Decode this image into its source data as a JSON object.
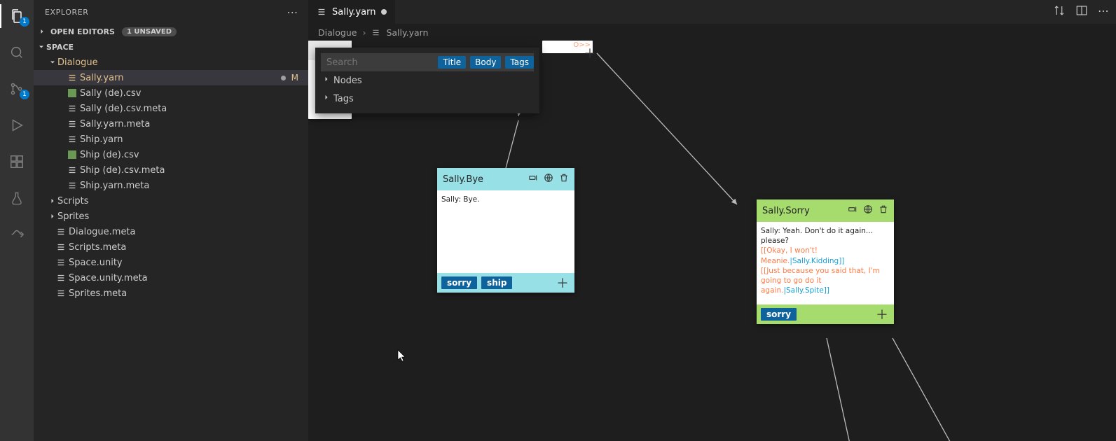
{
  "activity": {
    "badge_files": "1",
    "badge_scm": "1"
  },
  "explorer": {
    "title": "EXPLORER",
    "open_editors": "OPEN EDITORS",
    "unsaved_label": "1 UNSAVED",
    "workspace": "SPACE",
    "folders": {
      "dialogue": "Dialogue",
      "scripts": "Scripts",
      "sprites": "Sprites"
    },
    "files": {
      "sally_yarn": "Sally.yarn",
      "sally_de_csv": "Sally (de).csv",
      "sally_de_csv_meta": "Sally (de).csv.meta",
      "sally_yarn_meta": "Sally.yarn.meta",
      "ship_yarn": "Ship.yarn",
      "ship_de_csv": "Ship (de).csv",
      "ship_de_csv_meta": "Ship (de).csv.meta",
      "ship_yarn_meta": "Ship.yarn.meta",
      "dialogue_meta": "Dialogue.meta",
      "scripts_meta": "Scripts.meta",
      "space_unity": "Space.unity",
      "space_unity_meta": "Space.unity.meta",
      "sprites_meta": "Sprites.meta"
    },
    "status_letter": "M"
  },
  "tab": {
    "label": "Sally.yarn"
  },
  "breadcrumb": {
    "a": "Dialogue",
    "b": "Sally.yarn"
  },
  "popover": {
    "placeholder": "Search",
    "chip_title": "Title",
    "chip_body": "Body",
    "chip_tags": "Tags",
    "item_nodes": "Nodes",
    "item_tags": "Tags"
  },
  "ghost_mid_text": "O>>",
  "nodes": {
    "bye": {
      "title": "Sally.Bye",
      "body": "Sally: Bye.",
      "tags": {
        "sorry": "sorry",
        "ship": "ship"
      }
    },
    "sorry": {
      "title": "Sally.Sorry",
      "line1": "Sally: Yeah. Don't do it again... please?",
      "opt1a": "[[Okay, I won't! Meanie.",
      "opt1b": "|Sally.Kidding]]",
      "opt2a": "[[Just because you said that, I'm going to go do it again.",
      "opt2b": "|Sally.Spite]]",
      "tags": {
        "sorry": "sorry"
      }
    }
  }
}
